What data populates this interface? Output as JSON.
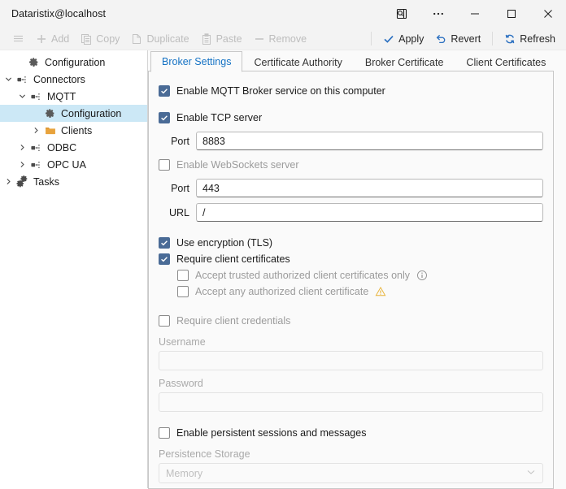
{
  "window": {
    "title": "Dataristix@localhost",
    "controls": {
      "search_panel": "search-panel-icon",
      "more": "…",
      "minimize": "minimize",
      "maximize": "maximize",
      "close": "close"
    }
  },
  "toolbar": {
    "menu_label": "",
    "items": [
      {
        "label": "Add",
        "icon": "plus-icon",
        "enabled": false
      },
      {
        "label": "Copy",
        "icon": "copy-icon",
        "enabled": false
      },
      {
        "label": "Duplicate",
        "icon": "duplicate-icon",
        "enabled": false
      },
      {
        "label": "Paste",
        "icon": "paste-icon",
        "enabled": false
      },
      {
        "label": "Remove",
        "icon": "minus-icon",
        "enabled": false
      }
    ],
    "actions": [
      {
        "label": "Apply",
        "icon": "check-icon",
        "enabled": true
      },
      {
        "label": "Revert",
        "icon": "undo-icon",
        "enabled": true
      },
      {
        "label": "Refresh",
        "icon": "refresh-icon",
        "enabled": true
      }
    ]
  },
  "sidebar": {
    "items": [
      {
        "label": "Configuration",
        "icon": "gear-icon",
        "indent": 1,
        "twisty": "",
        "selected": false
      },
      {
        "label": "Connectors",
        "icon": "plug-icon",
        "indent": 0,
        "twisty": "expanded",
        "selected": false
      },
      {
        "label": "MQTT",
        "icon": "plug-icon",
        "indent": 1,
        "twisty": "expanded",
        "selected": false
      },
      {
        "label": "Configuration",
        "icon": "gear-icon",
        "indent": 3,
        "twisty": "",
        "selected": true
      },
      {
        "label": "Clients",
        "icon": "folder-icon",
        "indent": 2,
        "twisty": "collapsed",
        "selected": false
      },
      {
        "label": "ODBC",
        "icon": "plug-icon",
        "indent": 1,
        "twisty": "collapsed",
        "selected": false
      },
      {
        "label": "OPC UA",
        "icon": "plug-icon",
        "indent": 1,
        "twisty": "collapsed",
        "selected": false
      },
      {
        "label": "Tasks",
        "icon": "tasks-icon",
        "indent": 0,
        "twisty": "collapsed",
        "selected": false
      }
    ]
  },
  "tabs": [
    {
      "label": "Broker Settings",
      "active": true
    },
    {
      "label": "Certificate Authority",
      "active": false
    },
    {
      "label": "Broker Certificate",
      "active": false
    },
    {
      "label": "Client Certificates",
      "active": false
    }
  ],
  "form": {
    "enable_broker": {
      "label": "Enable MQTT Broker service on this computer",
      "checked": true
    },
    "enable_tcp": {
      "label": "Enable TCP server",
      "checked": true
    },
    "tcp_port": {
      "label": "Port",
      "value": "8883"
    },
    "enable_websockets": {
      "label": "Enable WebSockets server",
      "checked": false
    },
    "ws_port": {
      "label": "Port",
      "value": "443"
    },
    "ws_url": {
      "label": "URL",
      "value": "/"
    },
    "use_tls": {
      "label": "Use encryption (TLS)",
      "checked": true
    },
    "require_client_certs": {
      "label": "Require client certificates",
      "checked": true
    },
    "accept_trusted_only": {
      "label": "Accept trusted authorized client certificates only",
      "checked": false,
      "badge": "info-icon"
    },
    "accept_any": {
      "label": "Accept any authorized client certificate",
      "checked": false,
      "badge": "warning-icon"
    },
    "require_credentials": {
      "label": "Require client credentials",
      "checked": false
    },
    "username": {
      "label": "Username",
      "value": ""
    },
    "password": {
      "label": "Password",
      "value": ""
    },
    "enable_persistence": {
      "label": "Enable persistent sessions and messages",
      "checked": false
    },
    "persistence_storage": {
      "label": "Persistence Storage",
      "value": "Memory"
    }
  },
  "colors": {
    "accent_blue": "#1572c4",
    "checkbox_fill": "#4a6b96",
    "selection": "#cce8f6",
    "warning": "#e8b339",
    "folder": "#e8a33d"
  }
}
